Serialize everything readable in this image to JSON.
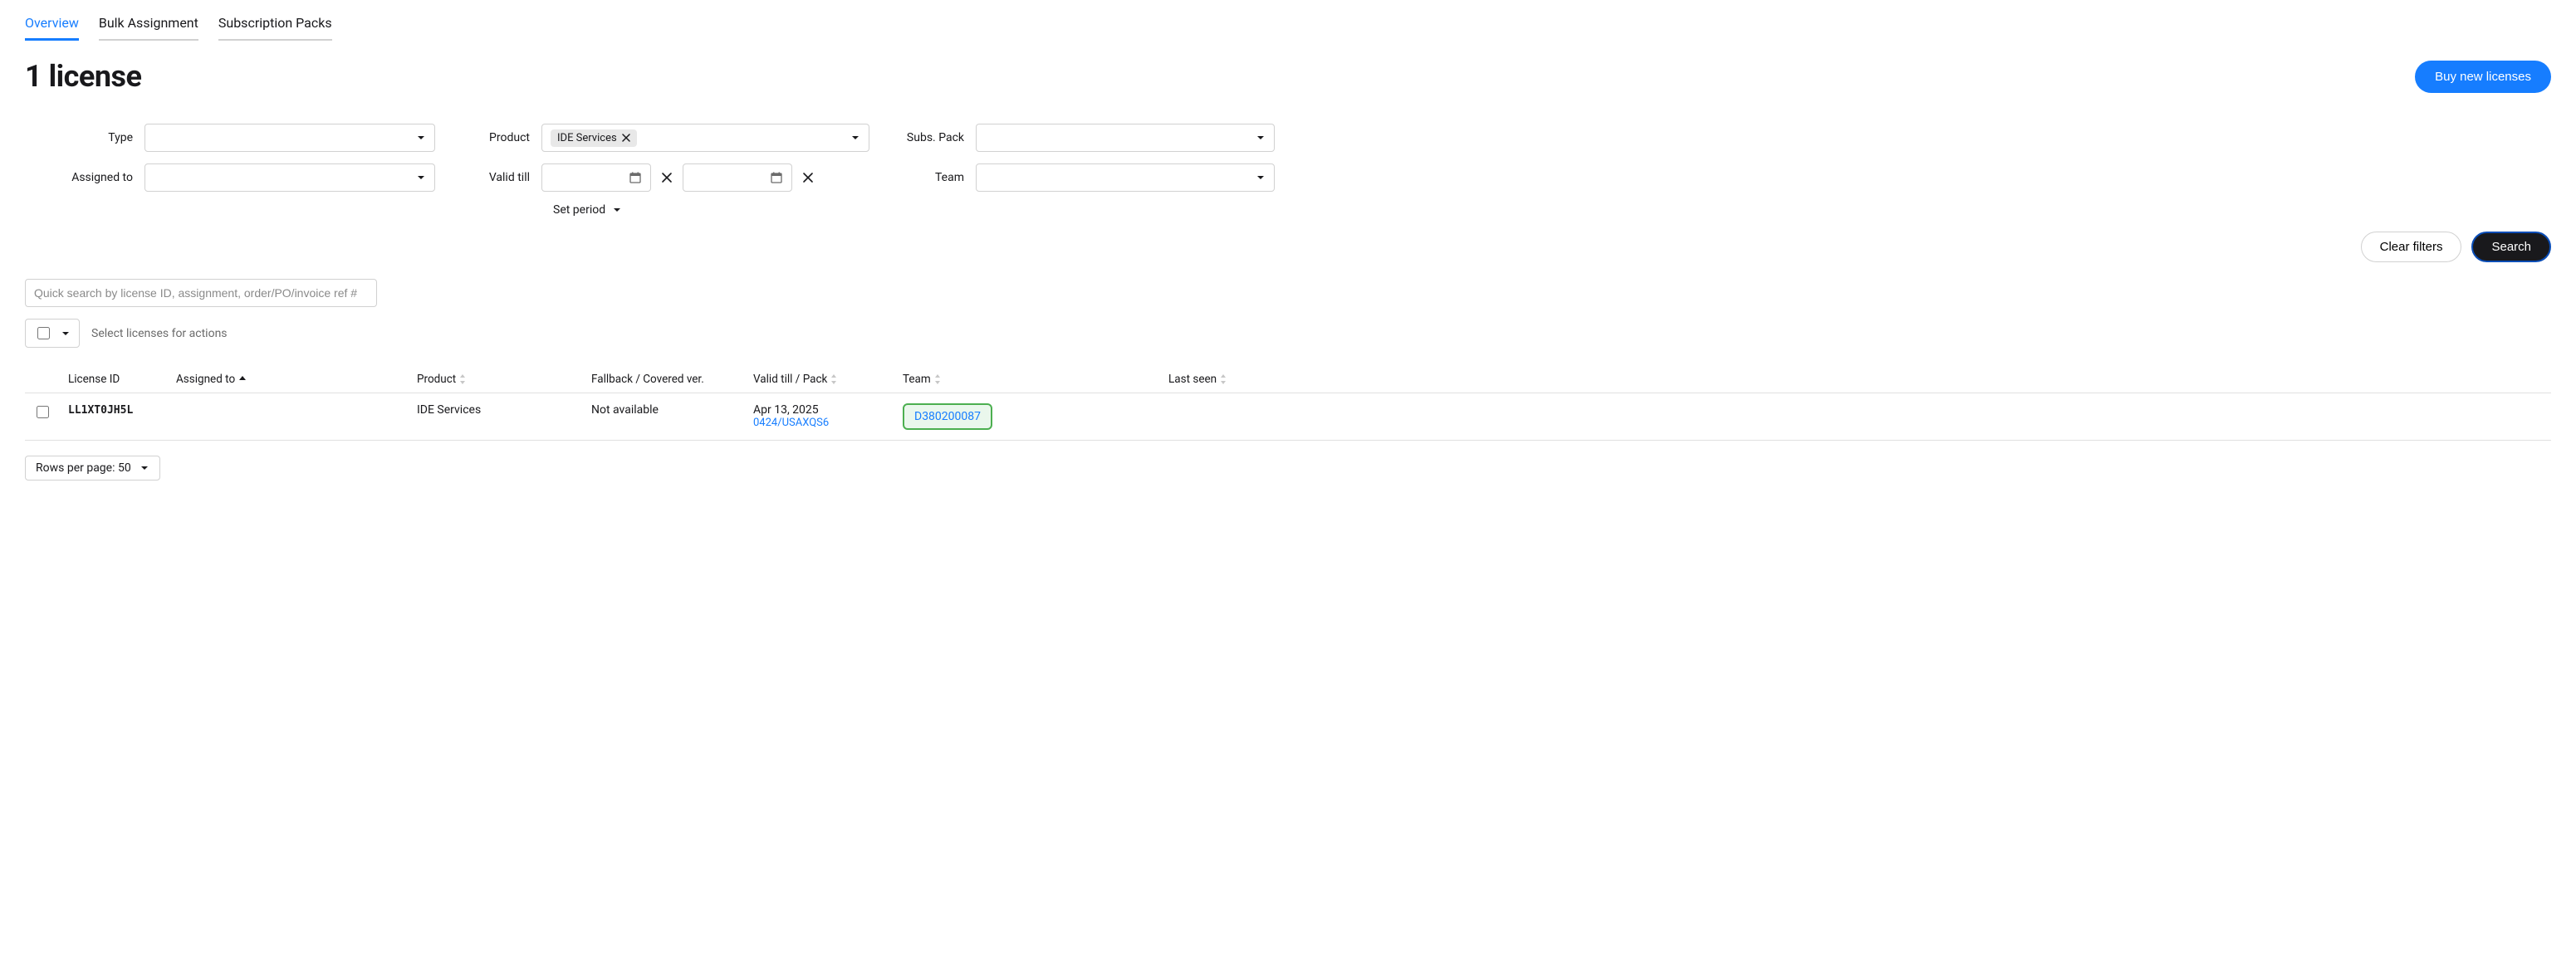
{
  "tabs": {
    "overview": "Overview",
    "bulk": "Bulk Assignment",
    "packs": "Subscription Packs"
  },
  "header": {
    "title": "1 license",
    "buy_button": "Buy new licenses"
  },
  "filters": {
    "type_label": "Type",
    "product_label": "Product",
    "product_chip": "IDE Services",
    "subs_label": "Subs. Pack",
    "assigned_label": "Assigned to",
    "validtill_label": "Valid till",
    "team_label": "Team",
    "set_period": "Set period"
  },
  "actions": {
    "clear": "Clear filters",
    "search": "Search"
  },
  "quick_search": {
    "placeholder": "Quick search by license ID, assignment, order/PO/invoice ref #"
  },
  "bulk": {
    "hint": "Select licenses for actions"
  },
  "table": {
    "cols": {
      "license_id": "License ID",
      "assigned_to": "Assigned to",
      "product": "Product",
      "fallback": "Fallback / Covered ver.",
      "valid_till": "Valid till / Pack",
      "team": "Team",
      "last_seen": "Last seen"
    },
    "rows": [
      {
        "license_id": "LL1XT0JH5L",
        "assigned_to": "",
        "product": "IDE Services",
        "fallback": "Not available",
        "valid_till": "Apr 13, 2025",
        "pack_ref": "0424/USAXQS6",
        "team": "D380200087",
        "last_seen": ""
      }
    ]
  },
  "pagination": {
    "rows_per_page_label": "Rows per page: 50"
  }
}
